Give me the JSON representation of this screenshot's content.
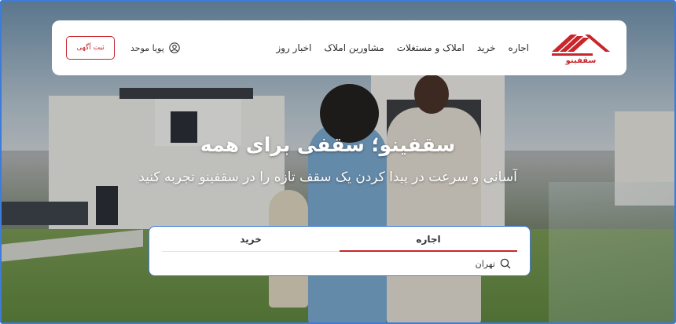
{
  "header": {
    "logo_text": "سقفینو",
    "nav": [
      "اجاره",
      "خرید",
      "املاک و مستغلات",
      "مشاورین املاک",
      "اخبار روز"
    ],
    "user_name": "پویا موحد",
    "post_ad_label": "ثبت آگهی"
  },
  "hero": {
    "title": "سقفینو؛ سقفی برای همه",
    "subtitle": "آسانی و سرعت در پیدا کردن یک سقف تازه را در سقفینو تجربه کنید"
  },
  "search": {
    "tabs": [
      "اجاره",
      "خرید"
    ],
    "active_tab": "اجاره",
    "value": "تهران"
  },
  "colors": {
    "accent": "#c9262c",
    "frame": "#3f7bd8"
  },
  "icons": {
    "user": "user-circle-icon",
    "search": "search-icon"
  }
}
